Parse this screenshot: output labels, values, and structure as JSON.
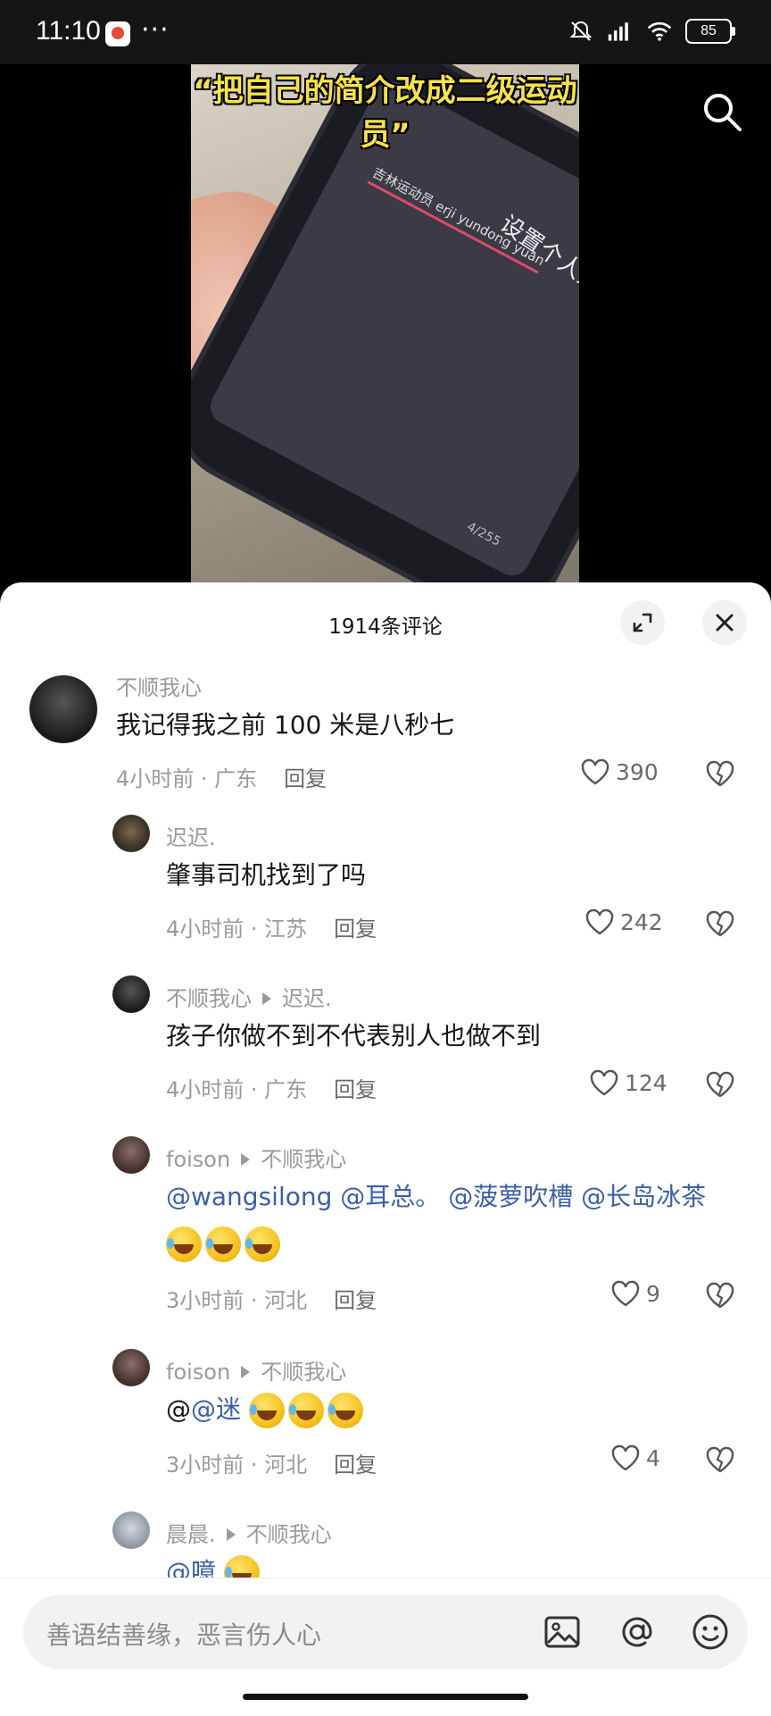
{
  "status_bar": {
    "time": "11:10",
    "overflow": "···",
    "battery": "85"
  },
  "video": {
    "caption": "“把自己的简介改成二级运动员”",
    "phone_screen_title": "设置个人介绍",
    "phone_typing": "吉林运动员 erji yundong yuan",
    "phone_counter": "4/255"
  },
  "sheet": {
    "title": "1914条评论"
  },
  "comments": [
    {
      "user": "不顺我心",
      "text": "我记得我之前 100 米是八秒七",
      "time": "4小时前",
      "region": "广东",
      "reply_label": "回复",
      "likes": "390"
    },
    {
      "user": "迟迟.",
      "text": "肇事司机找到了吗",
      "time": "4小时前",
      "region": "江苏",
      "reply_label": "回复",
      "likes": "242"
    },
    {
      "user": "不顺我心",
      "reply_to": "迟迟.",
      "text": "孩子你做不到不代表别人也做不到",
      "time": "4小时前",
      "region": "广东",
      "reply_label": "回复",
      "likes": "124"
    },
    {
      "user": "foison",
      "reply_to": "不顺我心",
      "mentions": [
        "@wangsilong",
        "@耳总。",
        "@菠萝吹槽",
        "@长岛冰茶"
      ],
      "time": "3小时前",
      "region": "河北",
      "reply_label": "回复",
      "likes": "9"
    },
    {
      "user": "foison",
      "reply_to": "不顺我心",
      "prefix": "@",
      "mention": "@迷",
      "time": "3小时前",
      "region": "河北",
      "reply_label": "回复",
      "likes": "4"
    },
    {
      "user": "晨晨.",
      "reply_to": "不顺我心",
      "mention": "@噫"
    }
  ],
  "input": {
    "placeholder": "善语结善缘，恶言伤人心"
  },
  "icons": {
    "search": "search-icon",
    "expand": "expand-icon",
    "close": "close-icon",
    "like": "heart-icon",
    "dislike": "broken-heart-icon",
    "image": "image-icon",
    "at": "at-icon",
    "emoji": "emoji-icon"
  }
}
